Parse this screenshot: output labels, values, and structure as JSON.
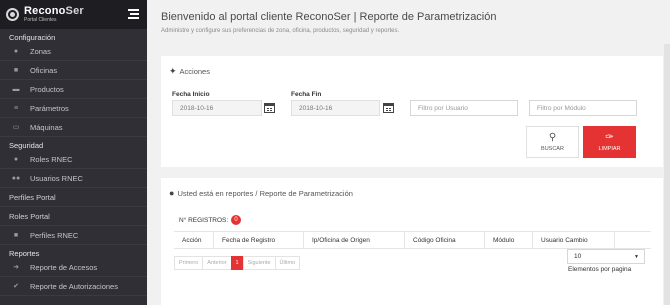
{
  "sidebar": {
    "brand_name_a": "Recono",
    "brand_name_b": "Ser",
    "brand_sub": "Portal Clientes",
    "sections": {
      "configuracion": "Configuración",
      "seguridad": "Seguridad",
      "reportes": "Reportes"
    },
    "items": {
      "zonas": "Zonas",
      "oficinas": "Oficinas",
      "productos": "Productos",
      "parametros": "Parámetros",
      "maquinas": "Máquinas",
      "roles_rnec": "Roles RNEC",
      "usuarios_rnec": "Usuarios RNEC",
      "perfiles_portal": "Perfiles Portal",
      "roles_portal": "Roles Portal",
      "perfiles_rnec": "Perfiles RNEC",
      "reporte_accesos": "Reporte de Accesos",
      "reporte_autorizaciones": "Reporte de Autorizaciones"
    }
  },
  "header": {
    "title": "Bienvenido al portal cliente ReconoSer | Reporte de Parametrización",
    "subtitle": "Administre y configure sus preferencias de zona, oficina, productos, seguridad y reportes."
  },
  "acciones": {
    "title": "Acciones",
    "fecha_inicio_label": "Fecha Inicio",
    "fecha_inicio_value": "2018-10-16",
    "fecha_fin_label": "Fecha Fin",
    "fecha_fin_value": "2018-10-16",
    "filtro_usuario_placeholder": "Filtro por Usuario",
    "filtro_modulo_placeholder": "Filtro por Módulo",
    "buscar_label": "BUSCAR",
    "limpiar_label": "LIMPIAR"
  },
  "reportes": {
    "breadcrumb": "Usted está en reportes / Reporte de Parametrización",
    "registros_label": "N° REGISTROS:",
    "registros_count": "0",
    "columns": [
      "Acción",
      "Fecha de Registro",
      "Ip/Oficina de Origen",
      "Código Oficina",
      "Módulo",
      "Usuario Cambio"
    ],
    "pager": {
      "first": "Primero",
      "prev": "Anterior",
      "current": "1",
      "next": "Siguiente",
      "last": "Último"
    },
    "page_size": "10",
    "page_size_label": "Elementos por pagina"
  },
  "colors": {
    "sidebar_bg": "#2f2f35",
    "accent_red": "#e53333"
  }
}
